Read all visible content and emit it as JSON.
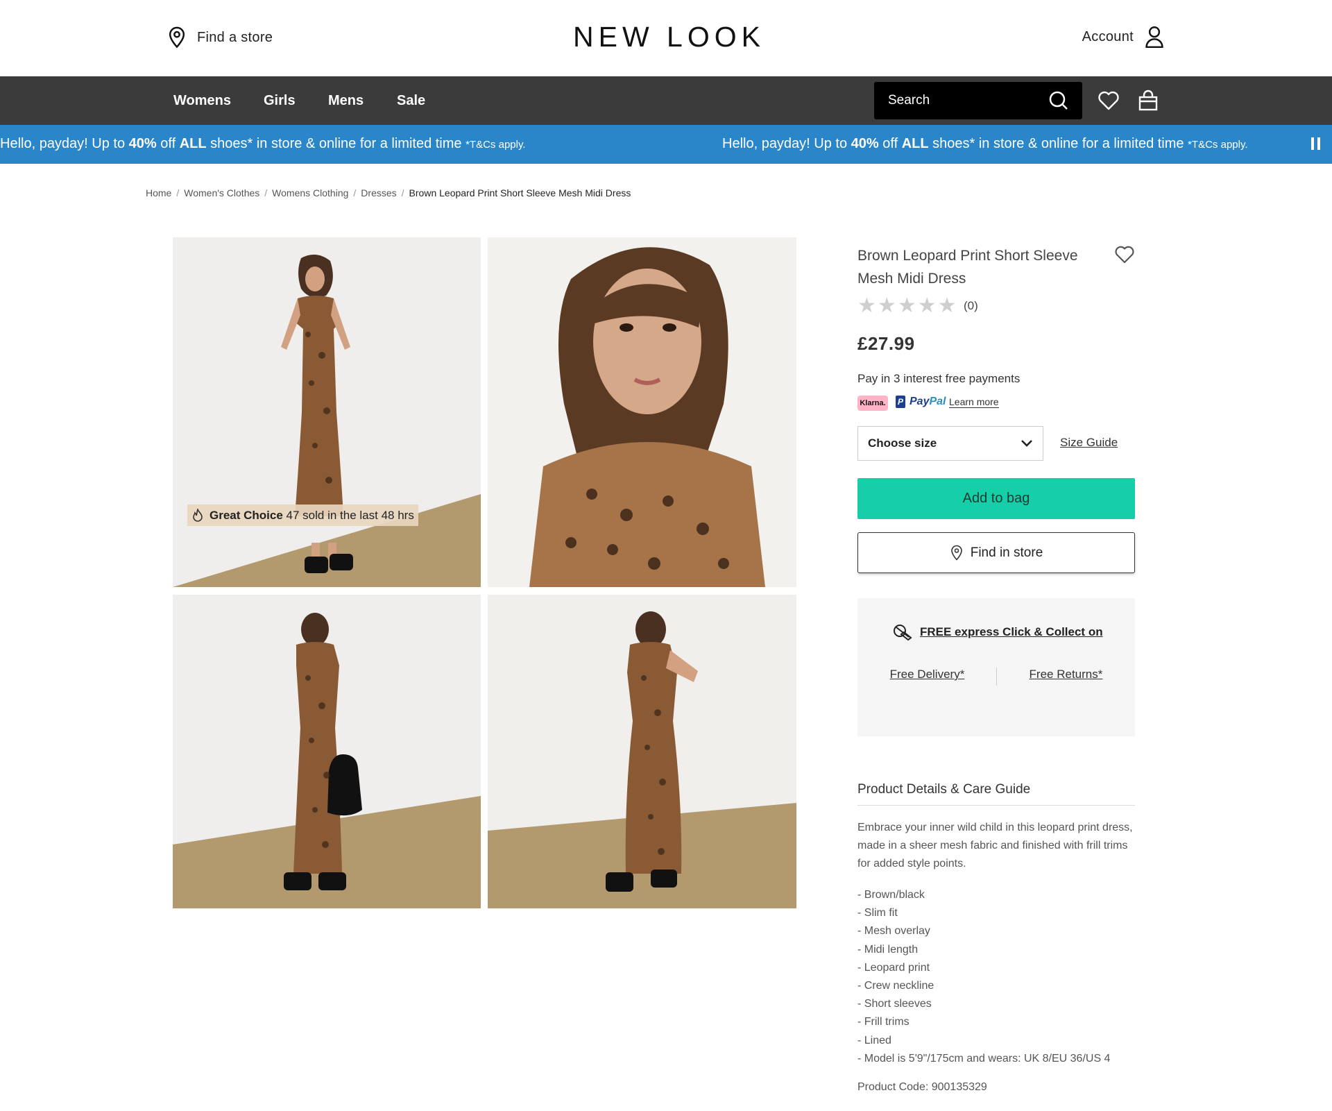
{
  "header": {
    "find_store": "Find a store",
    "logo": "NEW LOOK",
    "account": "Account"
  },
  "nav": {
    "items": [
      "Womens",
      "Girls",
      "Mens",
      "Sale"
    ],
    "search_placeholder": "Search"
  },
  "promo": {
    "pre": "Hello, payday! Up to ",
    "discount": "40%",
    "mid1": " off ",
    "all": "ALL",
    "post": " shoes* in store & online for a limited time ",
    "terms": "*T&Cs apply."
  },
  "breadcrumb": [
    "Home",
    "Women's Clothes",
    "Womens Clothing",
    "Dresses",
    "Brown Leopard Print Short Sleeve Mesh Midi Dress"
  ],
  "gallery": {
    "badge_bold": "Great Choice",
    "badge_text": " 47 sold in the last 48 hrs"
  },
  "product": {
    "title": "Brown Leopard Print Short Sleeve Mesh Midi Dress",
    "rating": 0,
    "review_count": "(0)",
    "price": "£27.99",
    "pay_in": "Pay in 3 interest free payments",
    "klarna": "Klarna.",
    "paypal_p": "P",
    "paypal_pay": "Pay",
    "paypal_pal": "Pal",
    "learn_more": "Learn more",
    "size_placeholder": "Choose size",
    "size_guide": "Size Guide",
    "add_to_bag": "Add to bag",
    "find_in_store": "Find in store"
  },
  "delivery": {
    "headline": "FREE express Click & Collect on",
    "free_delivery": "Free Delivery*",
    "free_returns": "Free Returns*"
  },
  "details": {
    "heading": "Product Details & Care Guide",
    "description": "Embrace your inner wild child in this leopard print dress, made in a sheer mesh fabric and finished with frill trims for added style points.",
    "features": [
      "- Brown/black",
      "- Slim fit",
      "- Mesh overlay",
      "- Midi length",
      "- Leopard print",
      "- Crew neckline",
      "- Short sleeves",
      "- Frill trims",
      "- Lined",
      "- Model is 5'9\"/175cm and wears: UK 8/EU 36/US 4"
    ],
    "product_code": "Product Code: 900135329"
  },
  "colors": {
    "nav_bg": "#3b3b3b",
    "promo_bg": "#2a86c8",
    "add_to_bag_bg": "#16cfa8",
    "klarna_pink": "#ffb3c7"
  }
}
